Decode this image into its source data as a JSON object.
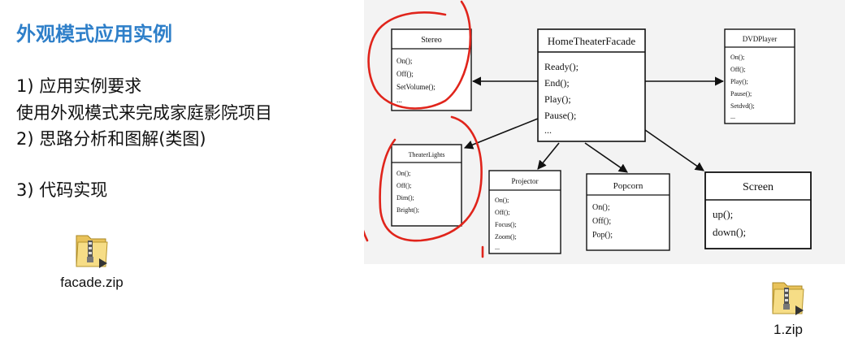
{
  "slide": {
    "title": "外观模式应用实例",
    "line1": "1)  应用实例要求",
    "line2": "使用外观模式来完成家庭影院项目",
    "line3": "2)  思路分析和图解(类图)",
    "line4": "3)  代码实现"
  },
  "files": [
    {
      "name": "facade.zip",
      "icon": "zip-folder-icon"
    },
    {
      "name": "1.zip",
      "icon": "zip-folder-icon"
    }
  ],
  "diagram": {
    "facade": {
      "name": "HomeTheaterFacade",
      "methods": [
        "Ready();",
        "End();",
        "Play();",
        "Pause();",
        "..."
      ]
    },
    "stereo": {
      "name": "Stereo",
      "methods": [
        "On();",
        "Off();",
        "SetVolume();",
        "..."
      ]
    },
    "dvd": {
      "name": "DVDPlayer",
      "methods": [
        "On();",
        "Off();",
        "Play();",
        "Pause();",
        "Setdvd();",
        "..."
      ]
    },
    "lights": {
      "name": "TheaterLights",
      "methods": [
        "On();",
        "Off();",
        "Dim();",
        "Bright();"
      ]
    },
    "projector": {
      "name": "Projector",
      "methods": [
        "On();",
        "Off();",
        "Focus();",
        "Zoom();",
        "..."
      ]
    },
    "popcorn": {
      "name": "Popcorn",
      "methods": [
        "On();",
        "Off();",
        "Pop();"
      ]
    },
    "screen": {
      "name": "Screen",
      "methods": [
        "up();",
        "down();"
      ]
    },
    "annotation_color": "#e0241b"
  }
}
